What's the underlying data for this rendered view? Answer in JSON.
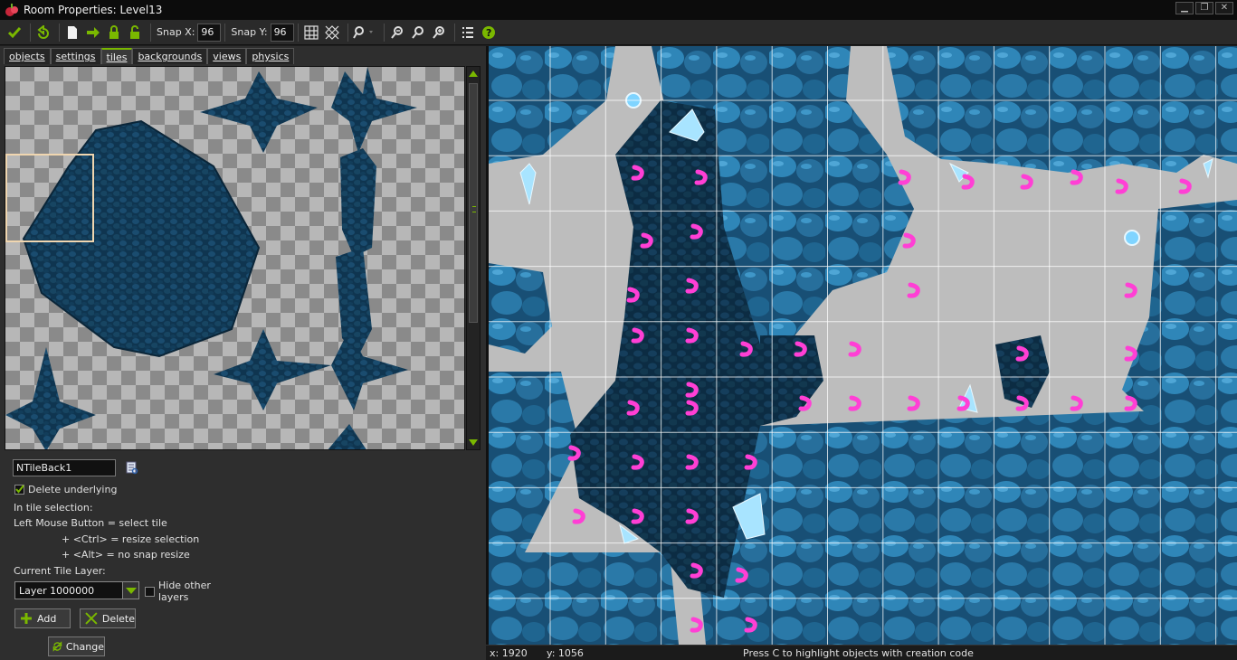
{
  "window": {
    "title": "Room Properties: Level13",
    "controls": [
      "minimize",
      "restore",
      "close"
    ]
  },
  "toolbar": {
    "snap_x_label": "Snap X:",
    "snap_x_value": "96",
    "snap_y_label": "Snap Y:",
    "snap_y_value": "96",
    "icons": [
      "confirm-icon",
      "undo-icon",
      "clear-icon",
      "shift-icon",
      "lock-icon",
      "unlock-icon",
      "grid-icon",
      "isometric-grid-icon",
      "zoom-options-icon",
      "zoom-out-icon",
      "zoom-reset-icon",
      "zoom-in-icon",
      "list-icon",
      "help-icon"
    ]
  },
  "tabs": [
    {
      "label": "objects"
    },
    {
      "label": "settings"
    },
    {
      "label": "tiles",
      "active": true
    },
    {
      "label": "backgrounds"
    },
    {
      "label": "views"
    },
    {
      "label": "physics"
    }
  ],
  "tile_panel": {
    "tile_name": "NTileBack1",
    "delete_underlying": "Delete underlying",
    "delete_underlying_checked": true,
    "help_heading": "In tile selection:",
    "help_line1": "Left Mouse Button  = select tile",
    "help_line2": "+ <Ctrl> = resize selection",
    "help_line3": "+ <Alt> =  no snap resize",
    "layer_label": "Current Tile Layer:",
    "layer_value": "Layer 1000000",
    "hide_other_layers": "Hide other layers",
    "hide_other_checked": false,
    "add_button": "Add",
    "delete_button": "Delete",
    "change_button": "Change"
  },
  "status": {
    "x": "x: 1920",
    "y": "y: 1056",
    "message": "Press C to highlight objects with creation code"
  },
  "colors": {
    "accent": "#7ab800",
    "tile_dark": "#0f3550",
    "tile_mid": "#1a5a85",
    "tile_light": "#2f86b8",
    "crystal": "#a8e4ff",
    "marker": "#ff3fd5",
    "room_bg": "#bdbdbd"
  }
}
